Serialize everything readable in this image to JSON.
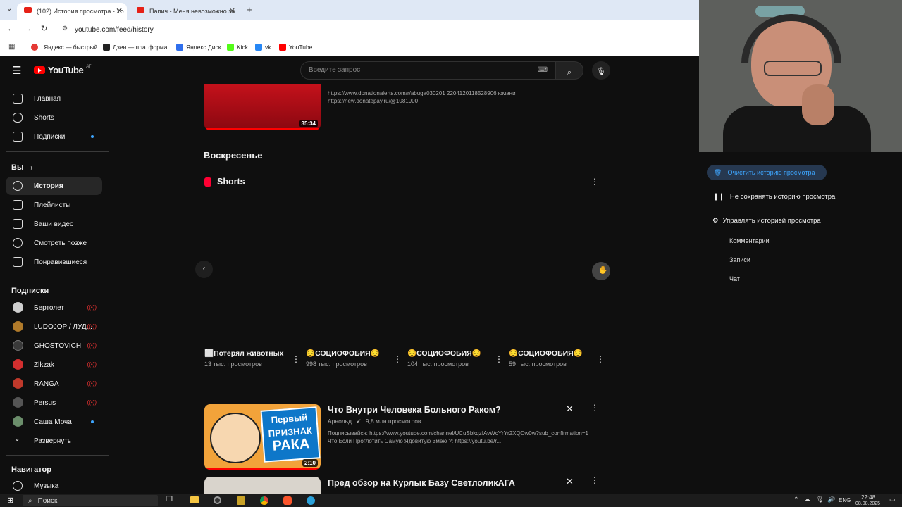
{
  "browser": {
    "tabs": [
      {
        "label": "(102) История просмотра - Yo",
        "active": true
      },
      {
        "label": "Папич - Меня невозможно за",
        "active": false
      }
    ],
    "new_tab": "+",
    "url": "youtube.com/feed/history",
    "bookmarks": [
      {
        "label": "Яндекс — быстрый...",
        "color": "#e53935"
      },
      {
        "label": "Дзен — платформа...",
        "color": "#222222"
      },
      {
        "label": "Яндекс Диск",
        "color": "#2f6fed"
      },
      {
        "label": "Kick",
        "color": "#53fc18"
      },
      {
        "label": "vk",
        "color": "#2787f5"
      },
      {
        "label": "YouTube",
        "color": "#ff0000"
      }
    ]
  },
  "youtube": {
    "logo": "YouTube",
    "logo_region": "AT",
    "search_placeholder": "Введите запрос",
    "sidebar": {
      "main": [
        {
          "label": "Главная",
          "icon": "home-icon"
        },
        {
          "label": "Shorts",
          "icon": "shorts-icon"
        },
        {
          "label": "Подписки",
          "icon": "subscriptions-icon"
        }
      ],
      "you_header": "Вы",
      "you": [
        {
          "label": "История",
          "icon": "history-icon",
          "selected": true
        },
        {
          "label": "Плейлисты",
          "icon": "playlists-icon"
        },
        {
          "label": "Ваши видео",
          "icon": "your-videos-icon"
        },
        {
          "label": "Смотреть позже",
          "icon": "watch-later-icon"
        },
        {
          "label": "Понравившиеся",
          "icon": "liked-icon"
        }
      ],
      "subs_header": "Подписки",
      "subs": [
        {
          "label": "Бертолет",
          "color": "#cfcfcf",
          "live": true
        },
        {
          "label": "LUDOJOP / ЛУД...",
          "color": "#b07a2a",
          "live": true
        },
        {
          "label": "GHOSTOVICH",
          "color": "#3a3a3a",
          "live": true
        },
        {
          "label": "Zlkzak",
          "color": "#d32f2f",
          "live": true
        },
        {
          "label": "RANGA",
          "color": "#c0392b",
          "live": true
        },
        {
          "label": "Persus",
          "color": "#555555",
          "live": true
        },
        {
          "label": "Саша Моча",
          "color": "#6b8e6b",
          "live": false
        }
      ],
      "expand": "Развернуть",
      "navigator_header": "Навигатор",
      "navigator": [
        {
          "label": "Музыка",
          "icon": "music-icon"
        }
      ]
    },
    "top_video": {
      "duration": "35:34",
      "desc_line1": "https://www.donationalerts.com/r/abuga030201 2204120118528906 юмани",
      "desc_line2": "https://new.donatepay.ru/@1081900"
    },
    "section_day": "Воскресенье",
    "shorts_header": "Shorts",
    "shorts": [
      {
        "title": "⬜Потерял животных",
        "views": "13 тыс. просмотров"
      },
      {
        "title": "😔СОЦИОФОБИЯ😔",
        "views": "998 тыс. просмотров"
      },
      {
        "title": "😔СОЦИОФОБИЯ😔",
        "views": "104 тыс. просмотров"
      },
      {
        "title": "😔СОЦИОФОБИЯ😔",
        "views": "59 тыс. просмотров"
      }
    ],
    "videos": [
      {
        "title": "Что Внутри Человека Больного Раком?",
        "channel": "Арнольд",
        "views": "9,8 млн просмотров",
        "desc_line1": "Подписывайся: https://www.youtube.com/channel/UCuSbkqzIAvWcYrYr2XQDw0w?sub_confirmation=1",
        "desc_line2": "Что Если Проглотить Самую Ядовитую Змею ?: https://youtu.be/r...",
        "duration": "2:10",
        "thumb_text1": "Первый",
        "thumb_text2": "признак",
        "thumb_text3": "РАКА"
      },
      {
        "title": "Пред обзор на Курлык Базу СветлоликАГА"
      }
    ]
  },
  "right_panel": {
    "clear_history": "Очистить историю просмотра",
    "pause_history": "Не сохранять историю просмотра",
    "manage_history": "Управлять историей просмотра",
    "links": [
      "Комментарии",
      "Записи",
      "Чат"
    ]
  },
  "taskbar": {
    "search": "Поиск",
    "lang": "ENG",
    "time": "22:48",
    "date": "08.08.2025"
  }
}
